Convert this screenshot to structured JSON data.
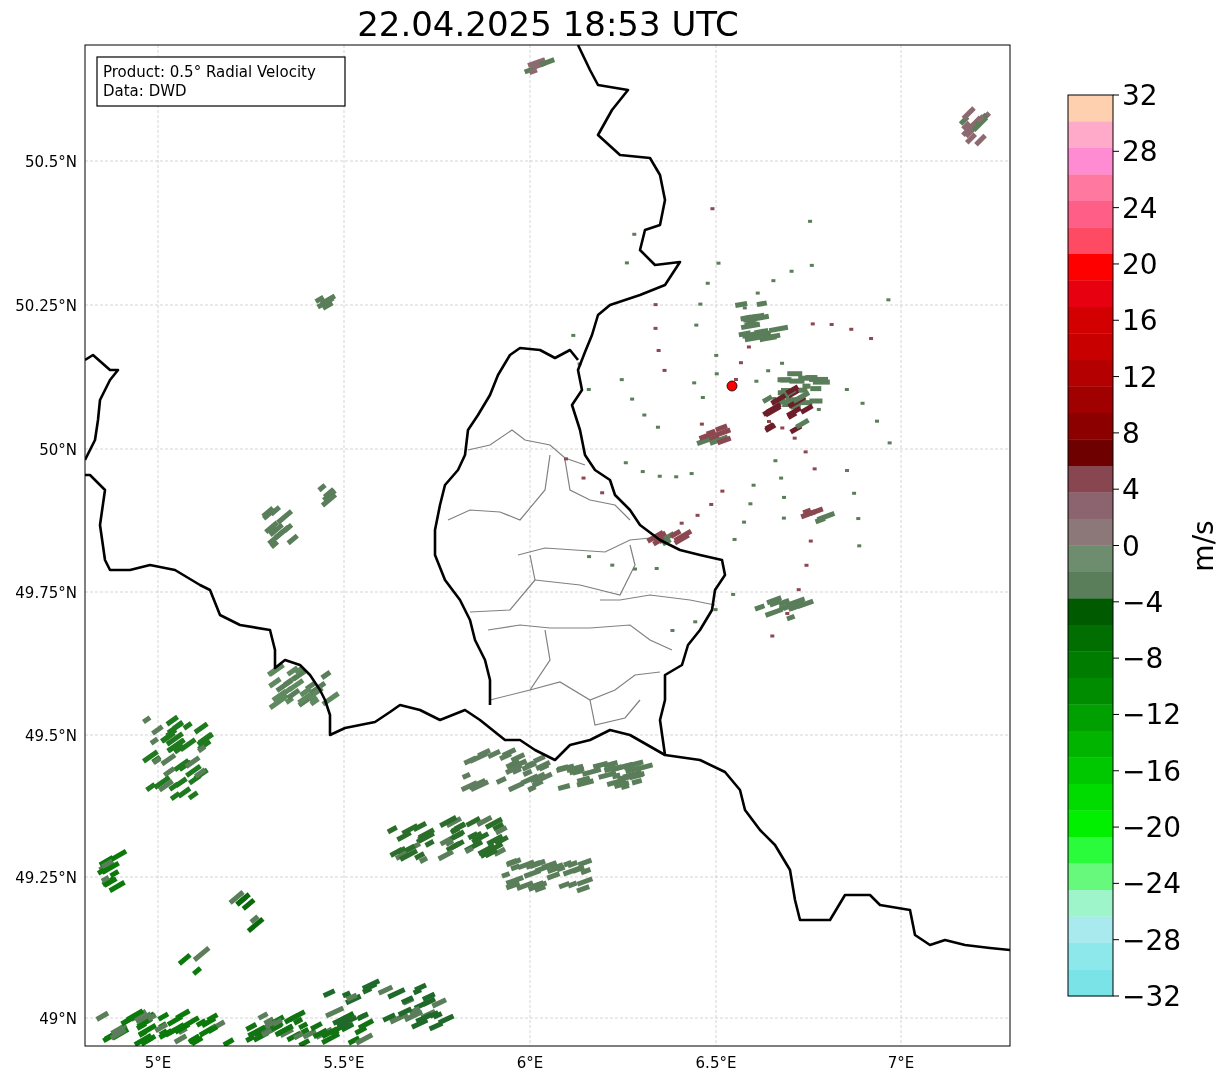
{
  "title": "22.04.2025 18:53 UTC",
  "legend": [
    "Product: 0.5° Radial Velocity",
    "Data: DWD"
  ],
  "x_ticks": [
    "5°E",
    "5.5°E",
    "6°E",
    "6.5°E",
    "7°E"
  ],
  "y_ticks": [
    "50.5°N",
    "50.25°N",
    "50°N",
    "49.75°N",
    "49.5°N",
    "49.25°N",
    "49°N"
  ],
  "colorbar": {
    "label": "m/s",
    "ticks": [
      "32",
      "28",
      "24",
      "20",
      "16",
      "12",
      "8",
      "4",
      "0",
      "−4",
      "−8",
      "−12",
      "−16",
      "−20",
      "−24",
      "−28",
      "−32"
    ],
    "bands": [
      {
        "color": "#ffd0b0"
      },
      {
        "color": "#ffaac8"
      },
      {
        "color": "#ff8cd2"
      },
      {
        "color": "#ff78a0"
      },
      {
        "color": "#ff5f87"
      },
      {
        "color": "#ff4a64"
      },
      {
        "color": "#ff0000"
      },
      {
        "color": "#e60010"
      },
      {
        "color": "#d20000"
      },
      {
        "color": "#c80000"
      },
      {
        "color": "#b40000"
      },
      {
        "color": "#a00000"
      },
      {
        "color": "#8c0000"
      },
      {
        "color": "#6e0000"
      },
      {
        "color": "#874650"
      },
      {
        "color": "#8c6470"
      },
      {
        "color": "#8c7878"
      },
      {
        "color": "#6e8c6e"
      },
      {
        "color": "#5a7d5a"
      },
      {
        "color": "#005a00"
      },
      {
        "color": "#006e00"
      },
      {
        "color": "#007d00"
      },
      {
        "color": "#008c00"
      },
      {
        "color": "#00a000"
      },
      {
        "color": "#00b400"
      },
      {
        "color": "#00c800"
      },
      {
        "color": "#00dc00"
      },
      {
        "color": "#00f000"
      },
      {
        "color": "#2afc3c"
      },
      {
        "color": "#66f97c"
      },
      {
        "color": "#9ef5c9"
      },
      {
        "color": "#a8eaee"
      },
      {
        "color": "#8ce8ea"
      },
      {
        "color": "#7ae3e8"
      }
    ]
  }
}
